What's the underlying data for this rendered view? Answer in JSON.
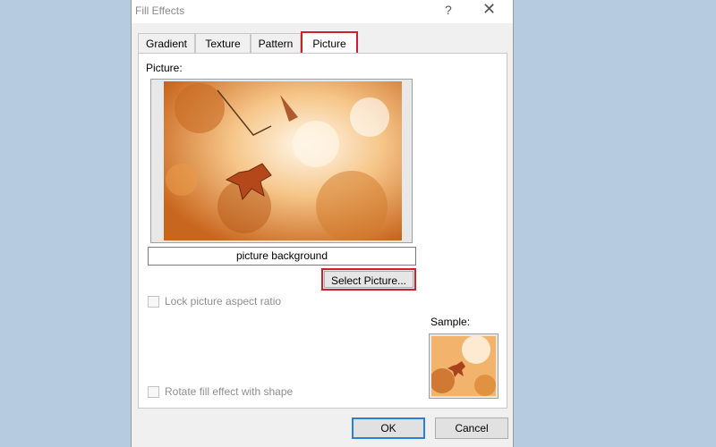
{
  "window": {
    "title": "Fill Effects",
    "help_symbol": "?",
    "close_symbol": "✕"
  },
  "tabs": [
    {
      "label": "Gradient"
    },
    {
      "label": "Texture"
    },
    {
      "label": "Pattern"
    },
    {
      "label": "Picture",
      "selected": true
    }
  ],
  "panel": {
    "picture_label": "Picture:",
    "picture_name": "picture background",
    "select_button": "Select Picture...",
    "lock_aspect": {
      "label": "Lock picture aspect ratio",
      "checked": false,
      "enabled": false
    },
    "rotate_fill": {
      "label": "Rotate fill effect with shape",
      "checked": false,
      "enabled": false
    },
    "sample_label": "Sample:"
  },
  "footer": {
    "ok": "OK",
    "cancel": "Cancel"
  },
  "colors": {
    "highlight": "#d21f2d",
    "default_button": "#2a7fd6",
    "background": "#b7cbe0"
  },
  "icons": [
    "help-icon",
    "close-icon"
  ]
}
